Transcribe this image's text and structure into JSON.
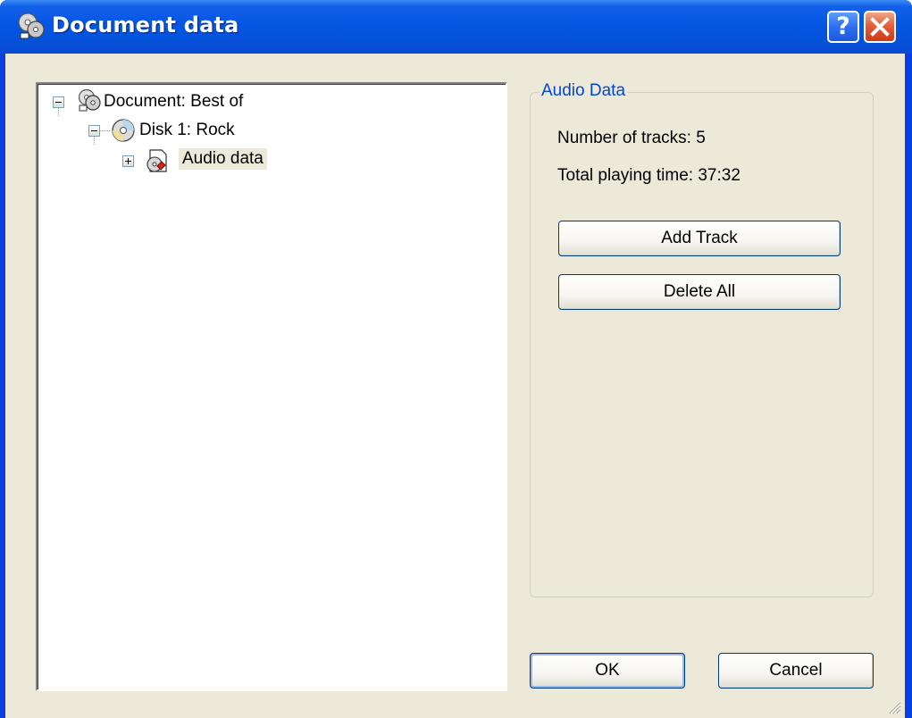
{
  "window": {
    "title": "Document data",
    "help_glyph": "?",
    "close_glyph": "×"
  },
  "tree": {
    "root": {
      "label": "Document: Best of",
      "icon": "document-cds-icon",
      "expanded": true
    },
    "disk": {
      "label": "Disk 1: Rock",
      "icon": "cd-disc-icon",
      "expanded": true
    },
    "audio": {
      "label": "Audio data",
      "icon": "audio-data-icon",
      "expanded": false,
      "selected": true
    }
  },
  "group": {
    "legend": "Audio Data",
    "tracks_text": "Number of tracks: 5",
    "time_text": "Total playing time: 37:32",
    "add_track_label": "Add Track",
    "delete_all_label": "Delete All"
  },
  "footer": {
    "ok_label": "OK",
    "cancel_label": "Cancel"
  },
  "colors": {
    "titlebar": "#0757e6",
    "dialog_bg": "#ece9d8",
    "legend_text": "#0046d5",
    "button_border": "#003c74"
  }
}
